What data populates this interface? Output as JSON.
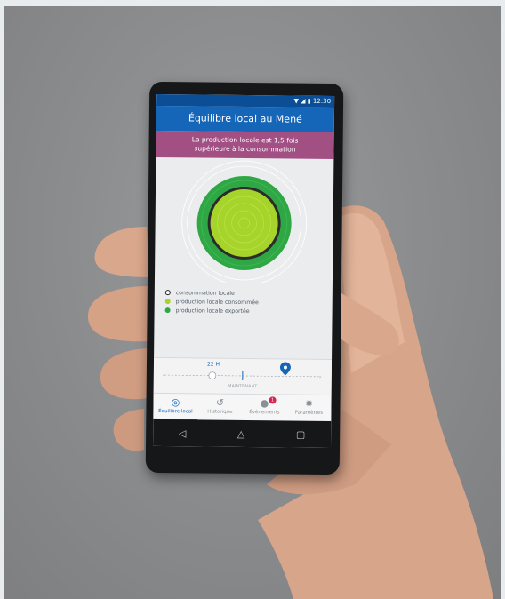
{
  "status_bar": {
    "time": "12:30",
    "icons": [
      "wifi-icon",
      "signal-icon",
      "battery-icon"
    ]
  },
  "app": {
    "title": "Équilibre local au Mené"
  },
  "banner": {
    "line1": "La production locale est 1,5 fois",
    "line2": "supérieure à la consommation",
    "color": "#a24f84"
  },
  "legend": [
    {
      "label": "consommation locale",
      "color": "#222222"
    },
    {
      "label": "production locale consommée",
      "color": "#a7d42b"
    },
    {
      "label": "production locale exportée",
      "color": "#2fa745"
    }
  ],
  "timeline": {
    "time_label": "22 H",
    "now_label": "MAINTENANT"
  },
  "nav": [
    {
      "label": "Équilibre local",
      "icon": "target-icon",
      "active": true
    },
    {
      "label": "Historique",
      "icon": "history-icon",
      "active": false
    },
    {
      "label": "Évènements",
      "icon": "alert-icon",
      "active": false,
      "badge": "1"
    },
    {
      "label": "Paramètres",
      "icon": "gear-icon",
      "active": false
    }
  ],
  "colors": {
    "header_blue": "#1565b8",
    "status_blue": "#0b4e96",
    "inner_green": "#a7d42b",
    "outer_green": "#2fa745",
    "ring_dark": "#2b2b2b"
  }
}
